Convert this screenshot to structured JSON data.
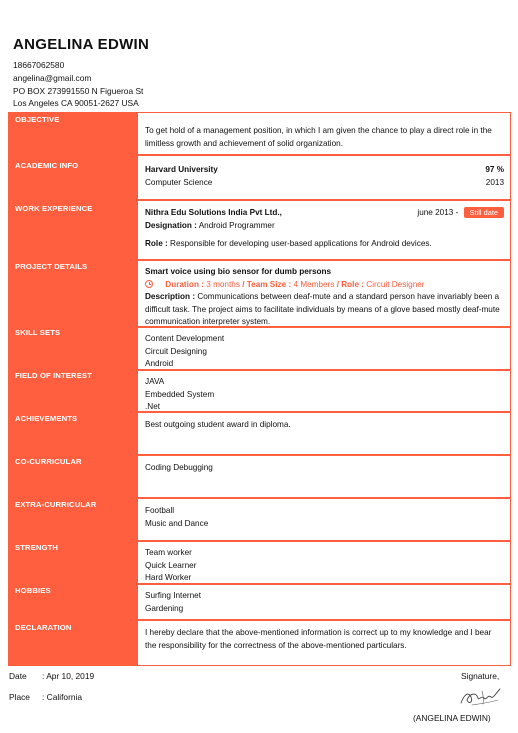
{
  "header": {
    "name": "ANGELINA EDWIN",
    "phone": "18667062580",
    "email": "angelina@gmail.com",
    "address_line1": "PO BOX 273991550 N Figueroa St",
    "address_line2": "Los Angeles CA 90051-2627 USA"
  },
  "labels": {
    "objective": "OBJECTIVE",
    "academic": "ACADEMIC INFO",
    "work": "WORK EXPERIENCE",
    "project": "PROJECT DETAILS",
    "skills": "SKILL SETS",
    "interest": "FIELD OF INTEREST",
    "achievements": "ACHIEVEMENTS",
    "cocurricular": "CO-CURRICULAR",
    "extracurricular": "EXTRA-CURRICULAR",
    "strength": "STRENGTH",
    "hobbies": "HOBBIES",
    "declaration": "DECLARATION"
  },
  "objective": {
    "text": "To get hold of a management position, in which I am given the chance to play a direct role in the limitless growth and achievement of solid organization."
  },
  "academic": {
    "institution": "Harvard University",
    "score": "97 %",
    "course": "Computer Science",
    "year": "2013"
  },
  "work": {
    "company": "Nithra Edu Solutions India Pvt Ltd.,",
    "start": "june 2013 -",
    "status": "Still date",
    "designation_label": "Designation :",
    "designation": "Android Programmer",
    "role_label": "Role :",
    "role": "Responsible for developing user-based applications for Android devices."
  },
  "project": {
    "title": "Smart voice using bio sensor for dumb persons",
    "duration_label": "Duration :",
    "duration": "3 months",
    "team_label": "/ Team Size :",
    "team": "4 Members",
    "role_label": "/ Role :",
    "role": "Circuit Designer",
    "desc_label": "Description :",
    "description": "Communications between deaf-mute and a standard person have invariably been a difficult task. The project aims to facilitate individuals by means of a glove based mostly deaf-mute communication interpreter system."
  },
  "skills": [
    "Content Development",
    "Circuit Designing",
    "Android"
  ],
  "interests": [
    "JAVA",
    "Embedded System",
    ".Net"
  ],
  "achievements": [
    "Best outgoing student award in diploma."
  ],
  "cocurricular": [
    "Coding Debugging"
  ],
  "extracurricular": [
    "Football",
    "Music and Dance"
  ],
  "strengths": [
    "Team worker",
    "Quick Learner",
    "Hard Worker"
  ],
  "hobbies": [
    "Surfing Internet",
    "Gardening"
  ],
  "declaration": {
    "text": "I hereby declare that the above-mentioned information is correct up to my knowledge and I bear the responsibility for the correctness of the above-mentioned particulars."
  },
  "footer": {
    "date_label": "Date",
    "date_value": ":   Apr 10, 2019",
    "place_label": "Place",
    "place_value": ":   California",
    "signature_label": "Signature,",
    "signature_name": "(ANGELINA EDWIN)"
  },
  "colors": {
    "accent": "#FF5F3F",
    "text": "#111111"
  }
}
